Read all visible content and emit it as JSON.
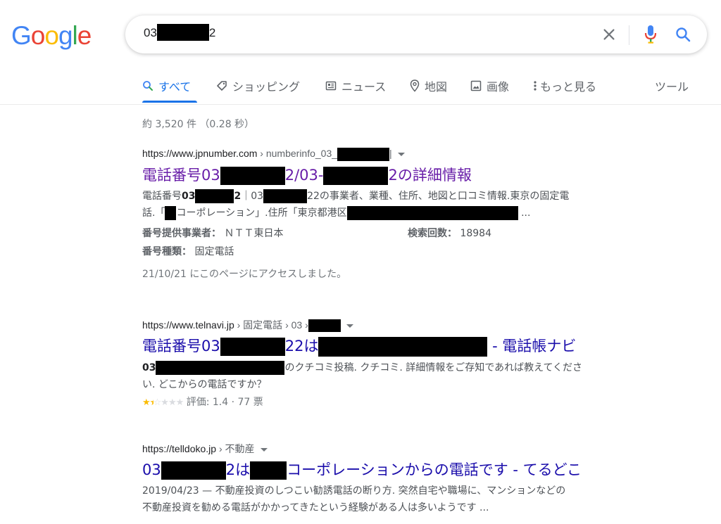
{
  "logo": {
    "letters": [
      "G",
      "o",
      "o",
      "g",
      "l",
      "e"
    ],
    "colors": [
      "#4285f4",
      "#ea4335",
      "#fbbc05",
      "#4285f4",
      "#34a853",
      "#ea4335"
    ]
  },
  "search": {
    "query_prefix": "03",
    "query_suffix": "2"
  },
  "tabs": [
    {
      "label": "すべて",
      "icon": "search-icon",
      "active": true
    },
    {
      "label": "ショッピング",
      "icon": "tag-icon"
    },
    {
      "label": "ニュース",
      "icon": "news-icon"
    },
    {
      "label": "地図",
      "icon": "map-pin-icon"
    },
    {
      "label": "画像",
      "icon": "image-icon"
    },
    {
      "label": "もっと見る",
      "icon": "more-vert-icon"
    },
    {
      "label": "ツール"
    }
  ],
  "stats": "約 3,520 件 （0.28 秒）",
  "results": [
    {
      "site": "https://www.jpnumber.com",
      "path": " › numberinfo_03_",
      "title_a": "電話番号03",
      "title_b": "2/03-",
      "title_c": "2の詳細情報",
      "snip1_a": "電話番号",
      "snip1_b": "03",
      "snip1_c": "2",
      "snip1_d": "｜03",
      "snip1_e": "22の事業者、業種、住所、地図と口コミ情報.東京の固定電",
      "snip2_a": "話.「",
      "snip2_b": "コーポレーション」.住所「東京都港区",
      "snip2_c": " ...",
      "row1_label": "番号提供事業者：",
      "row1_value": " ＮＴＴ東日本",
      "row1_label2": "検索回数：",
      "row1_value2": " 18984",
      "row2_label": "番号種類：",
      "row2_value": " 固定電話",
      "visited": "21/10/21 にこのページにアクセスしました。"
    },
    {
      "site": "https://www.telnavi.jp",
      "path": " › 固定電話 › 03 ›",
      "title_a": "電話番号03",
      "title_b": "22は",
      "title_c": " - 電話帳ナビ",
      "snip1_a": "03",
      "snip1_b": "のクチコミ投稿. クチコミ. 詳細情報をご存知であれば教えてくださ",
      "snip2": "い. どこからの電話ですか？",
      "rating_label": "評価: 1.4 · 77 票",
      "rating_value": 1.4
    },
    {
      "site": "https://telldoko.jp",
      "path": " › 不動産",
      "title_a": "03",
      "title_b": "2は",
      "title_c": "コーポレーションからの電話です - てるどこ",
      "snip1": "2019/04/23 — 不動産投資のしつこい勧誘電話の断り方. 突然自宅や職場に、マンションなどの",
      "snip2": "不動産投資を勧める電話がかかってきたという経験がある人は多いようです ..."
    }
  ],
  "colors": {
    "link": "#1a0dab",
    "visited": "#681da8",
    "accent": "#1a73e8",
    "star": "#fbbc04"
  }
}
